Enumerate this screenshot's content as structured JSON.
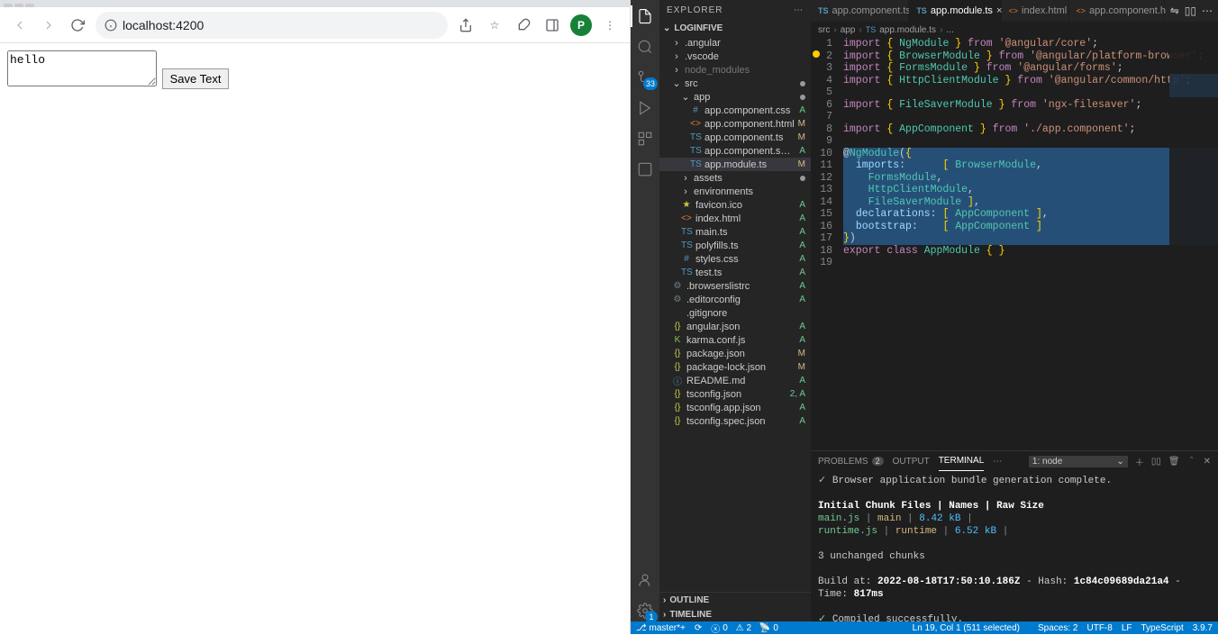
{
  "browser": {
    "url": "localhost:4200",
    "avatar_letter": "P",
    "textarea_value": "hello",
    "save_button": "Save Text"
  },
  "vscode": {
    "explorer_label": "EXPLORER",
    "project_name": "LOGINFIVE",
    "outline_label": "OUTLINE",
    "timeline_label": "TIMELINE",
    "scm_badge": "33",
    "settings_badge": "1",
    "tree": [
      {
        "depth": 1,
        "kind": "folder",
        "name": ".angular",
        "open": false,
        "git": ""
      },
      {
        "depth": 1,
        "kind": "folder",
        "name": ".vscode",
        "open": false,
        "git": ""
      },
      {
        "depth": 1,
        "kind": "folder",
        "name": "node_modules",
        "open": false,
        "git": "",
        "dim": true
      },
      {
        "depth": 1,
        "kind": "folder",
        "name": "src",
        "open": true,
        "git": "",
        "dot": true
      },
      {
        "depth": 2,
        "kind": "folder",
        "name": "app",
        "open": true,
        "git": "",
        "dot": true
      },
      {
        "depth": 3,
        "kind": "file",
        "icon": "#",
        "iconColor": "#519aba",
        "name": "app.component.css",
        "git": "A"
      },
      {
        "depth": 3,
        "kind": "file",
        "icon": "<>",
        "iconColor": "#e37933",
        "name": "app.component.html",
        "git": "M"
      },
      {
        "depth": 3,
        "kind": "file",
        "icon": "TS",
        "iconColor": "#519aba",
        "name": "app.component.ts",
        "git": "M"
      },
      {
        "depth": 3,
        "kind": "file",
        "icon": "TS",
        "iconColor": "#519aba",
        "name": "app.component.spec.ts",
        "git": "A"
      },
      {
        "depth": 3,
        "kind": "file",
        "icon": "TS",
        "iconColor": "#519aba",
        "name": "app.module.ts",
        "git": "M",
        "active": true
      },
      {
        "depth": 2,
        "kind": "folder",
        "name": "assets",
        "open": false,
        "git": "",
        "dot": true
      },
      {
        "depth": 2,
        "kind": "folder",
        "name": "environments",
        "open": false,
        "git": ""
      },
      {
        "depth": 2,
        "kind": "file",
        "icon": "★",
        "iconColor": "#cbcb41",
        "name": "favicon.ico",
        "git": "A"
      },
      {
        "depth": 2,
        "kind": "file",
        "icon": "<>",
        "iconColor": "#e37933",
        "name": "index.html",
        "git": "A"
      },
      {
        "depth": 2,
        "kind": "file",
        "icon": "TS",
        "iconColor": "#519aba",
        "name": "main.ts",
        "git": "A"
      },
      {
        "depth": 2,
        "kind": "file",
        "icon": "TS",
        "iconColor": "#519aba",
        "name": "polyfills.ts",
        "git": "A"
      },
      {
        "depth": 2,
        "kind": "file",
        "icon": "#",
        "iconColor": "#519aba",
        "name": "styles.css",
        "git": "A"
      },
      {
        "depth": 2,
        "kind": "file",
        "icon": "TS",
        "iconColor": "#519aba",
        "name": "test.ts",
        "git": "A"
      },
      {
        "depth": 1,
        "kind": "file",
        "icon": "⚙",
        "iconColor": "#6d8086",
        "name": ".browserslistrc",
        "git": "A"
      },
      {
        "depth": 1,
        "kind": "file",
        "icon": "⚙",
        "iconColor": "#6d8086",
        "name": ".editorconfig",
        "git": "A"
      },
      {
        "depth": 1,
        "kind": "file",
        "icon": "",
        "iconColor": "#6d8086",
        "name": ".gitignore",
        "git": ""
      },
      {
        "depth": 1,
        "kind": "file",
        "icon": "{}",
        "iconColor": "#cbcb41",
        "name": "angular.json",
        "git": "A"
      },
      {
        "depth": 1,
        "kind": "file",
        "icon": "K",
        "iconColor": "#8dc149",
        "name": "karma.conf.js",
        "git": "A"
      },
      {
        "depth": 1,
        "kind": "file",
        "icon": "{}",
        "iconColor": "#cbcb41",
        "name": "package.json",
        "git": "M"
      },
      {
        "depth": 1,
        "kind": "file",
        "icon": "{}",
        "iconColor": "#cbcb41",
        "name": "package-lock.json",
        "git": "M"
      },
      {
        "depth": 1,
        "kind": "file",
        "icon": "ⓘ",
        "iconColor": "#519aba",
        "name": "README.md",
        "git": "A"
      },
      {
        "depth": 1,
        "kind": "file",
        "icon": "{}",
        "iconColor": "#cbcb41",
        "name": "tsconfig.json",
        "git": "2, A"
      },
      {
        "depth": 1,
        "kind": "file",
        "icon": "{}",
        "iconColor": "#cbcb41",
        "name": "tsconfig.app.json",
        "git": "A"
      },
      {
        "depth": 1,
        "kind": "file",
        "icon": "{}",
        "iconColor": "#cbcb41",
        "name": "tsconfig.spec.json",
        "git": "A"
      }
    ],
    "tabs": [
      {
        "icon": "TS",
        "label": "app.component.ts",
        "active": false
      },
      {
        "icon": "TS",
        "label": "app.module.ts",
        "active": true,
        "close": true
      },
      {
        "icon": "<>",
        "label": "index.html",
        "active": false
      },
      {
        "icon": "<>",
        "label": "app.component.html",
        "active": false,
        "truncated": "app.component.h"
      }
    ],
    "breadcrumb": [
      "src",
      "app",
      "app.module.ts",
      "..."
    ],
    "code_lines": [
      "import { NgModule } from '@angular/core';",
      "import { BrowserModule } from '@angular/platform-browser';",
      "import { FormsModule } from '@angular/forms';",
      "import { HttpClientModule } from '@angular/common/http';",
      "",
      "import { FileSaverModule } from 'ngx-filesaver';",
      "",
      "import { AppComponent } from './app.component';",
      "",
      "@NgModule({",
      "  imports:      [ BrowserModule,",
      "    FormsModule,",
      "    HttpClientModule,",
      "    FileSaverModule ],",
      "  declarations: [ AppComponent ],",
      "  bootstrap:    [ AppComponent ]",
      "})",
      "export class AppModule { }",
      ""
    ],
    "terminal": {
      "panel_tabs": {
        "problems": "PROBLEMS",
        "problems_count": "2",
        "output": "OUTPUT",
        "terminal": "TERMINAL",
        "more": "⋯"
      },
      "shell_label": "1: node",
      "lines": {
        "l1": "✓ Browser application bundle generation complete.",
        "header_files": "Initial Chunk Files",
        "header_names": "Names",
        "header_size": "Raw Size",
        "row1_file": "main.js",
        "row1_name": "main",
        "row1_size": "8.42 kB",
        "row2_file": "runtime.js",
        "row2_name": "runtime",
        "row2_size": "6.52 kB",
        "unchanged": "3 unchanged chunks",
        "build_prefix": "Build at:",
        "build_time": "2022-08-18T17:50:10.186Z",
        "hash_label": "- Hash:",
        "hash": "1c84c09689da21a4",
        "time_label": "- Time:",
        "elapsed": "817ms",
        "success": "✓ Compiled successfully.",
        "prompt": "▯"
      }
    },
    "status": {
      "branch": "master*+",
      "sync": "⟳",
      "errors": "0",
      "warnings": "2",
      "ports": "0",
      "cursor": "Ln 19, Col 1 (511 selected)",
      "spaces": "Spaces: 2",
      "encoding": "UTF-8",
      "eol": "LF",
      "lang": "TypeScript",
      "version": "3.9.7"
    }
  }
}
